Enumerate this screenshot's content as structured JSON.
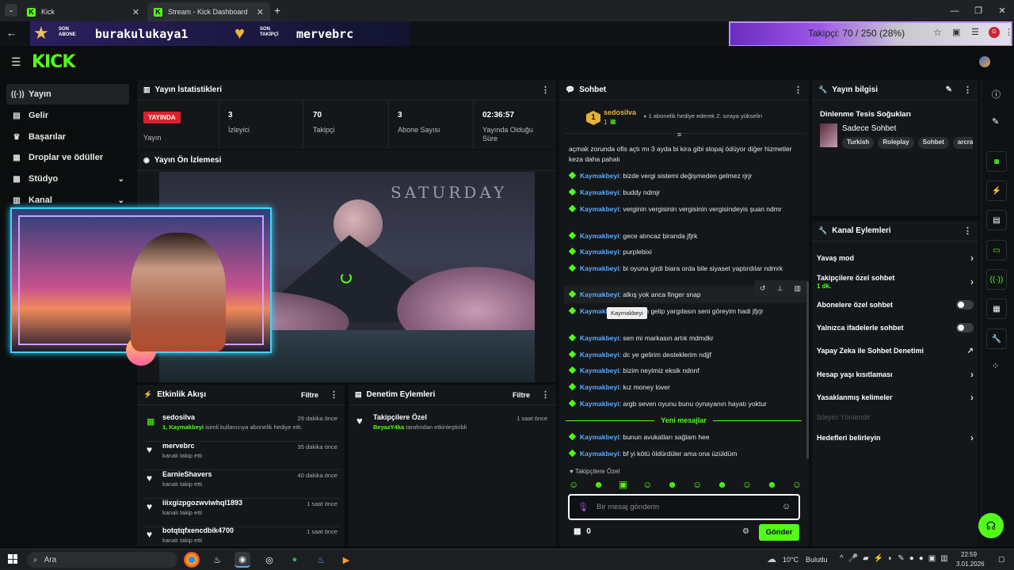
{
  "browser": {
    "tabs": [
      {
        "title": "Kick"
      },
      {
        "title": "Stream - Kick Dashboard"
      }
    ]
  },
  "overlay": {
    "last_sub_label": "SON\nABONE",
    "last_sub_name": "burakulukaya1",
    "last_follower_label": "SON\nTAKİPÇİ",
    "last_follower_name": "mervebrc",
    "follower_goal": "Takipçi: 70 / 250 (28%)"
  },
  "sidebar": {
    "items": [
      {
        "label": "Yayın",
        "icon": "broadcast-icon"
      },
      {
        "label": "Gelir",
        "icon": "money-icon"
      },
      {
        "label": "Başarılar",
        "icon": "trophy-icon"
      },
      {
        "label": "Droplar ve ödüller",
        "icon": "gift-icon"
      },
      {
        "label": "Stüdyo",
        "icon": "studio-icon"
      },
      {
        "label": "Kanal",
        "icon": "channel-icon"
      }
    ]
  },
  "stats": {
    "title": "Yayın İstatistikleri",
    "live_badge": "YAYINDA",
    "cells": [
      {
        "value": "",
        "label": "Yayın"
      },
      {
        "value": "3",
        "label": "İzleyici"
      },
      {
        "value": "70",
        "label": "Takipçi"
      },
      {
        "value": "3",
        "label": "Abone Sayısı"
      },
      {
        "value": "02:36:57",
        "label": "Yayında Olduğu Süre"
      }
    ]
  },
  "preview": {
    "title": "Yayın Ön İzlemesi",
    "overlay_text": "SATURDAY"
  },
  "activity": {
    "title": "Etkinlik Akışı",
    "filter": "Filtre",
    "items": [
      {
        "name": "sedosilva",
        "time": "29 dakika önce",
        "sub_user": "1, Kaymakbeyi",
        "sub": " isimli kullanıcıya abonelik hediye etti.",
        "icon": "gift-icon"
      },
      {
        "name": "mervebrc",
        "time": "35 dakika önce",
        "sub_user": "",
        "sub": "kanalı takip etti",
        "icon": "heart-icon"
      },
      {
        "name": "EarnieShavers",
        "time": "40 dakika önce",
        "sub_user": "",
        "sub": "kanalı takip etti",
        "icon": "heart-icon"
      },
      {
        "name": "iiixgizpgozwviwhql1893",
        "time": "1 saat önce",
        "sub_user": "",
        "sub": "kanalı takip etti",
        "icon": "heart-icon"
      },
      {
        "name": "botqtqfxencdbik4700",
        "time": "1 saat önce",
        "sub_user": "",
        "sub": "kanalı takip etti",
        "icon": "heart-icon"
      }
    ]
  },
  "moderation": {
    "title": "Denetim Eylemleri",
    "filter": "Filtre",
    "items": [
      {
        "title": "Takipçilere Özel",
        "time": "1 saat önce",
        "user": "BeyazY4ka",
        "desc": " tarafından etkinleştirildi"
      }
    ]
  },
  "chat": {
    "title": "Sohbet",
    "pinned_user": "sedosilva",
    "pinned_count": "1",
    "pinned_rank": "1",
    "pinned_text": "1 abonelik hediye ederek 2. sıraya yükselin",
    "messages": [
      {
        "user": "",
        "text": "açmak zorunda ofis açtı mı 3 ayda bi kira gibi stopaj ödüyor diğer hizmetler keza daha pahalı"
      },
      {
        "user": "Kaymakbeyi",
        "text": ": bizde vergi sistemi değişmeden gelmez rjrjr"
      },
      {
        "user": "Kaymakbeyi",
        "text": ": buddy ndmjr"
      },
      {
        "user": "Kaymakbeyi",
        "text": ": verginin vergisinin vergisinin vergisindeyis şuan ndmr"
      },
      {
        "user": "Kaymakbeyi",
        "text": ": gece alıncaz biranda jfjrk"
      },
      {
        "user": "Kaymakbeyi",
        "text": ": purplebixi"
      },
      {
        "user": "Kaymakbeyi",
        "text": ": bi oyuna girdi biara orda bile siyaset yaptırdılar ndmrk"
      },
      {
        "user": "Kaymakbeyi",
        "text": ": alkış yok anca finger snap"
      },
      {
        "user": "Kaymakbeyi",
        "text": ": güvenen gelip yargılasın seni göreyim hadi jfjrjr"
      },
      {
        "user": "Kaymakbeyi",
        "text": ": sen mi markasın artık mdmdkr"
      },
      {
        "user": "Kaymakbeyi",
        "text": ": dc ye gelirim desteklerim ndjjf"
      },
      {
        "user": "Kaymakbeyi",
        "text": ": bizim neyimiz eksik ndnnf"
      },
      {
        "user": "Kaymakbeyi",
        "text": ": kız money lover"
      },
      {
        "user": "Kaymakbeyi",
        "text": ": argb seven oyunu bunu oynayanın hayatı yoktur"
      }
    ],
    "new_divider": "Yeni mesajlar",
    "new_messages": [
      {
        "user": "Kaymakbeyi",
        "text": ": bunun avukatları sağlam hee"
      },
      {
        "user": "Kaymakbeyi",
        "text": ": bf yi kötü öldürdüler ama ona üzüldüm"
      }
    ],
    "tooltip": "Kaymakbeyi",
    "followers_only": "Takipçilere Özel",
    "input_placeholder": "Bir mesaj gönderin",
    "points": "0",
    "send": "Gönder"
  },
  "stream_info": {
    "title": "Yayın bilgisi",
    "stream_title": "Dinlenme Tesis Soğukları",
    "category": "Sadece Sohbet",
    "tags": [
      "Turkish",
      "Roleplay",
      "Sohbet",
      "arcra"
    ]
  },
  "channel_actions": {
    "title": "Kanal Eylemleri",
    "rows": [
      {
        "label": "Yavaş mod",
        "type": "chevron"
      },
      {
        "label": "Takipçilere özel sohbet",
        "extra": "1 dk.",
        "type": "chevron"
      },
      {
        "label": "Abonelere özel sohbet",
        "type": "toggle"
      },
      {
        "label": "Yalnızca ifadelerle sohbet",
        "type": "toggle"
      },
      {
        "label": "Yapay Zeka ile Sohbet Denetimi",
        "type": "external"
      },
      {
        "label": "Hesap yaşı kısıtlaması",
        "type": "chevron"
      },
      {
        "label": "Yasaklanmış kelimeler",
        "type": "chevron"
      },
      {
        "label": "İzleyici Yönlendir",
        "type": "disabled"
      },
      {
        "label": "Hedefleri belirleyin",
        "type": "chevron"
      }
    ]
  },
  "taskbar": {
    "search": "Ara",
    "weather": "10°C",
    "weather_desc": "Bulutlu",
    "time": "22:59",
    "date": "3.01.2026"
  },
  "colors": {
    "brand": "#53fc18",
    "live": "#e01f2c",
    "username": "#5aa9ff"
  }
}
